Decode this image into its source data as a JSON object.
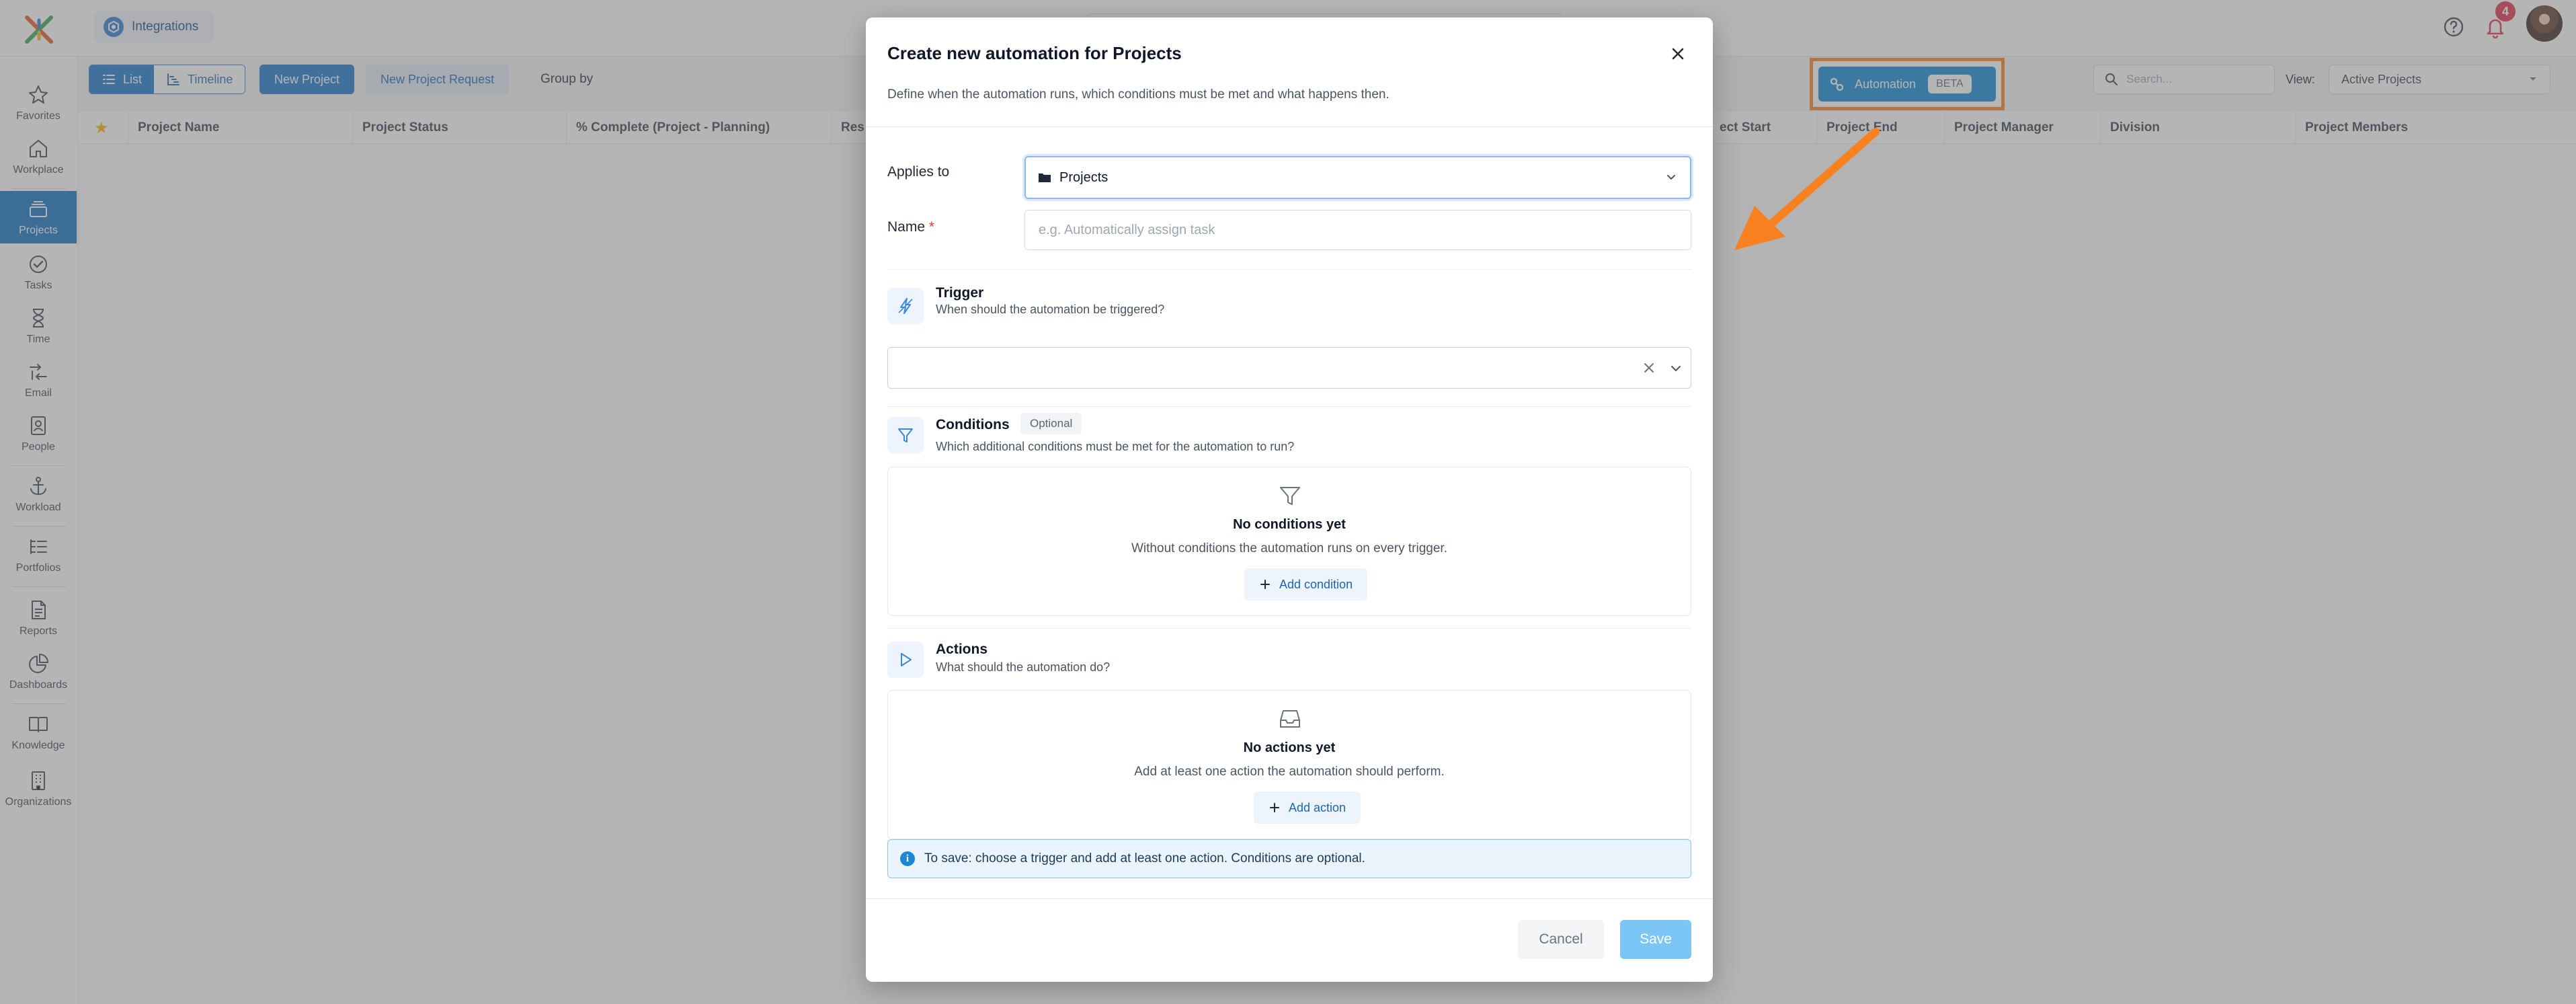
{
  "colors": {
    "accent": "#1874cd",
    "sidebar_active": "#0b6fc2",
    "highlight_frame": "#f7801f",
    "arrow": "#f7801f",
    "notification_badge": "#e12d4a",
    "save_disabled": "#7cc6f6",
    "info_box_bg": "#e9f4fc"
  },
  "topbar": {
    "logo_icon": "x-logo-icon",
    "integrations_label": "Integrations",
    "notification_count": "4"
  },
  "sidebar": {
    "items": [
      {
        "label": "Favorites",
        "icon": "star-icon"
      },
      {
        "label": "Workplace",
        "icon": "home-icon"
      },
      {
        "label": "Projects",
        "icon": "layers-icon",
        "active": true
      },
      {
        "label": "Tasks",
        "icon": "check-circle-icon"
      },
      {
        "label": "Time",
        "icon": "hourglass-icon"
      },
      {
        "label": "Email",
        "icon": "arrows-icon"
      },
      {
        "label": "People",
        "icon": "contact-icon"
      },
      {
        "label": "Workload",
        "icon": "anchor-icon"
      },
      {
        "label": "Portfolios",
        "icon": "list-icon"
      },
      {
        "label": "Reports",
        "icon": "document-icon"
      },
      {
        "label": "Dashboards",
        "icon": "pie-icon"
      },
      {
        "label": "Knowledge",
        "icon": "book-icon"
      },
      {
        "label": "Organizations",
        "icon": "building-icon"
      }
    ]
  },
  "toolbar": {
    "view_list": "List",
    "view_timeline": "Timeline",
    "new_project": "New Project",
    "new_project_request": "New Project Request",
    "group_by": "Group by",
    "automation_label": "Automation",
    "automation_badge": "BETA",
    "search_placeholder": "Search...",
    "view_label": "View:",
    "view_value": "Active Projects"
  },
  "table": {
    "columns": [
      "Project Name",
      "Project Status",
      "% Complete (Project - Planning)",
      "Res",
      "ect Start",
      "Project End",
      "Project Manager",
      "Division",
      "Project Members"
    ]
  },
  "modal": {
    "title": "Create new automation for Projects",
    "subtitle": "Define when the automation runs, which conditions must be met and what happens then.",
    "applies_to_label": "Applies to",
    "applies_to_value": "Projects",
    "name_label": "Name",
    "name_required_mark": "*",
    "name_placeholder": "e.g. Automatically assign task",
    "trigger": {
      "title": "Trigger",
      "description": "When should the automation be triggered?"
    },
    "conditions": {
      "title": "Conditions",
      "badge": "Optional",
      "description": "Which additional conditions must be met for the automation to run?",
      "empty_title": "No conditions yet",
      "empty_description": "Without conditions the automation runs on every trigger.",
      "add_label": "Add condition"
    },
    "actions": {
      "title": "Actions",
      "description": "What should the automation do?",
      "empty_title": "No actions yet",
      "empty_description": "Add at least one action the automation should perform.",
      "add_label": "Add action"
    },
    "info_text": "To save: choose a trigger and add at least one action. Conditions are optional.",
    "cancel_label": "Cancel",
    "save_label": "Save"
  }
}
